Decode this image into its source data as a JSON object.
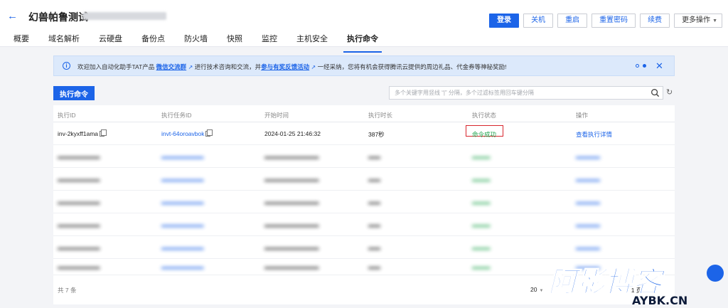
{
  "header": {
    "back_icon": "arrow-left-icon",
    "title": "幻兽帕鲁测试",
    "actions": [
      "登录",
      "关机",
      "重启",
      "重置密码",
      "续费",
      "更多操作"
    ]
  },
  "tabs": [
    "概要",
    "域名解析",
    "云硬盘",
    "备份点",
    "防火墙",
    "快照",
    "监控",
    "主机安全",
    "执行命令"
  ],
  "active_tab": "执行命令",
  "banner": {
    "text_1": "欢迎加入自动化助手TAT产品",
    "link_1": "微信交流群",
    "text_2": "进行技术咨询和交流，并",
    "link_2": "参与有奖反馈活动",
    "text_3": "一经采纳，您将有机会获得腾讯云提供的周边礼品、代金券等神秘奖励!"
  },
  "toolbar": {
    "run_label": "执行命令",
    "search_placeholder": "多个关键字用竖线 “|” 分隔，多个过滤标签用回车键分隔"
  },
  "table": {
    "headers": [
      "执行ID",
      "执行任务ID",
      "开始时间",
      "执行时长",
      "执行状态",
      "操作"
    ],
    "rows": [
      {
        "exec_id": "inv-2kyxff1ama",
        "task_id": "invt-64oroavbok",
        "start": "2024-01-25 21:46:32",
        "duration": "387秒",
        "status": "命令成功",
        "action": "查看执行详情"
      }
    ]
  },
  "footer": {
    "total": "共 7 条",
    "page_size": "20",
    "page_info": "/ 1 页"
  },
  "watermark": {
    "main": "阿影博客",
    "sub": "AYBK.CN"
  },
  "colors": {
    "accent": "#1c64e8",
    "success": "#20a44d",
    "highlight_border": "#d8262e",
    "banner_bg": "#dce9fb"
  }
}
